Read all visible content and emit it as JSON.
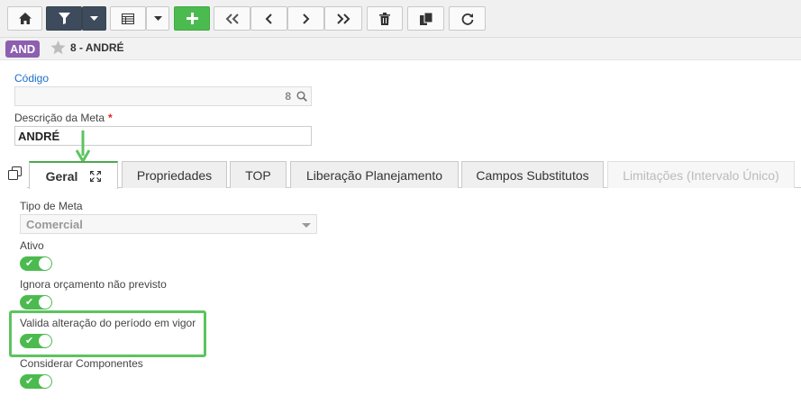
{
  "toolbar": {
    "buttons": [
      {
        "name": "home-button",
        "icon": "home-icon"
      },
      {
        "name": "filter-button",
        "icon": "filter-icon"
      },
      {
        "name": "filter-dropdown-button",
        "icon": "caret-down-icon"
      },
      {
        "name": "grid-view-button",
        "icon": "grid-icon"
      },
      {
        "name": "grid-dropdown-button",
        "icon": "caret-down-icon"
      },
      {
        "name": "add-button",
        "icon": "plus-icon"
      },
      {
        "name": "first-record-button",
        "icon": "double-chevron-left-icon"
      },
      {
        "name": "previous-record-button",
        "icon": "chevron-left-icon"
      },
      {
        "name": "next-record-button",
        "icon": "chevron-right-icon"
      },
      {
        "name": "last-record-button",
        "icon": "double-chevron-right-icon"
      },
      {
        "name": "delete-button",
        "icon": "trash-icon"
      },
      {
        "name": "duplicate-button",
        "icon": "copy-icon"
      },
      {
        "name": "refresh-button",
        "icon": "refresh-icon"
      }
    ],
    "accent_color": "#4cbb4f",
    "dark_color": "#3d4b5c"
  },
  "header": {
    "badge": "AND",
    "badge_color": "#8c5fb0",
    "title": "8 - ANDRÉ"
  },
  "form": {
    "code": {
      "label": "Código",
      "value": "8"
    },
    "description": {
      "label": "Descrição da Meta",
      "required_mark": "*",
      "value": "ANDRÉ"
    }
  },
  "tabs": [
    {
      "label": "Geral",
      "active": true
    },
    {
      "label": "Propriedades"
    },
    {
      "label": "TOP"
    },
    {
      "label": "Liberação Planejamento"
    },
    {
      "label": "Campos Substitutos"
    },
    {
      "label": "Limitações (Intervalo Único)",
      "disabled": true
    }
  ],
  "general": {
    "tipo_meta": {
      "label": "Tipo de Meta",
      "value": "Comercial"
    },
    "toggles": [
      {
        "label": "Ativo",
        "on": true
      },
      {
        "label": "Ignora orçamento não previsto",
        "on": true
      },
      {
        "label": "Valida alteração do período em vigor",
        "on": true
      },
      {
        "label": "Considerar Componentes",
        "on": true
      }
    ],
    "toggle_check": "✔",
    "highlight_color": "#5cc45e"
  }
}
